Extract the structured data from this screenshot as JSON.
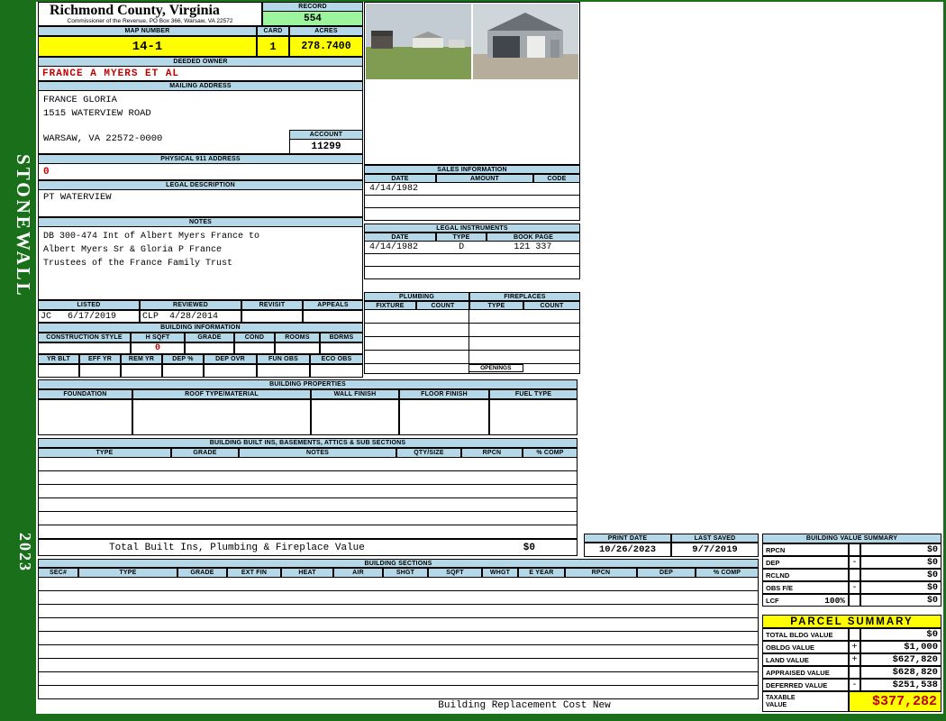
{
  "sidebar": {
    "district": "STONEWALL",
    "year": "2023"
  },
  "header": {
    "county": "Richmond County, Virginia",
    "commissioner_line": "Commissioner of the Revenue, PO Box 366, Warsaw, VA 22572",
    "record": {
      "label": "RECORD",
      "value": "554"
    },
    "map_number": {
      "label": "MAP NUMBER",
      "value": "14-1"
    },
    "card": {
      "label": "CARD",
      "value": "1"
    },
    "acres": {
      "label": "ACRES",
      "value": "278.7400"
    }
  },
  "owner": {
    "deeded_owner": {
      "label": "DEEDED OWNER",
      "value": "FRANCE A MYERS ET AL"
    },
    "mailing": {
      "label": "MAILING ADDRESS",
      "line1": "FRANCE GLORIA",
      "line2": "1515 WATERVIEW ROAD",
      "line3": "WARSAW, VA 22572-0000"
    },
    "account": {
      "label": "ACCOUNT",
      "value": "11299"
    },
    "physical911": {
      "label": "PHYSICAL 911 ADDRESS",
      "value": "0"
    },
    "legal_description": {
      "label": "LEGAL DESCRIPTION",
      "value": "PT WATERVIEW"
    },
    "notes": {
      "label": "NOTES",
      "line1": "DB 300-474 Int of Albert Myers France to",
      "line2": "Albert Myers Sr & Gloria P France",
      "line3": "Trustees of the France Family Trust"
    }
  },
  "sales": {
    "title": "SALES INFORMATION",
    "columns": [
      "DATE",
      "AMOUNT",
      "CODE"
    ],
    "rows": [
      [
        "4/14/1982",
        "",
        ""
      ]
    ]
  },
  "legal_instruments": {
    "title": "LEGAL INSTRUMENTS",
    "columns": [
      "DATE",
      "TYPE",
      "BOOK PAGE"
    ],
    "rows": [
      [
        "4/14/1982",
        "D",
        "121 337"
      ]
    ]
  },
  "plumbing": {
    "title": "PLUMBING",
    "columns": [
      "FIXTURE",
      "COUNT"
    ]
  },
  "fireplaces": {
    "title": "FIREPLACES",
    "columns": [
      "TYPE",
      "COUNT"
    ],
    "openings_label": "OPENINGS"
  },
  "review": {
    "listed_label": "LISTED",
    "listed_value": "JC   6/17/2019",
    "reviewed_label": "REVIEWED",
    "reviewed_value": "CLP  4/28/2014",
    "revisit_label": "REVISIT",
    "revisit_value": "",
    "appeals_label": "APPEALS",
    "appeals_value": ""
  },
  "building_info": {
    "title": "BUILDING INFORMATION",
    "row1_columns": [
      "CONSTRUCTION STYLE",
      "H SQFT",
      "GRADE",
      "COND",
      "ROOMS",
      "BDRMS"
    ],
    "h_sqft_value": "0",
    "row2_columns": [
      "YR BLT",
      "EFF YR",
      "REM YR",
      "DEP %",
      "DEP OVR",
      "FUN OBS",
      "ECO OBS"
    ]
  },
  "building_properties": {
    "title": "BUILDING PROPERTIES",
    "columns": [
      "FOUNDATION",
      "ROOF TYPE/MATERIAL",
      "WALL FINISH",
      "FLOOR FINISH",
      "FUEL TYPE"
    ]
  },
  "built_ins": {
    "title": "BUILDING BUILT INS, BASEMENTS, ATTICS & SUB SECTIONS",
    "columns": [
      "TYPE",
      "GRADE",
      "NOTES",
      "QTY/SIZE",
      "RPCN",
      "% COMP"
    ],
    "total_label": "Total Built Ins, Plumbing & Fireplace Value",
    "total_value": "$0"
  },
  "print_info": {
    "print_date_label": "PRINT DATE",
    "print_date": "10/26/2023",
    "last_saved_label": "LAST SAVED",
    "last_saved": "9/7/2019"
  },
  "building_value_summary": {
    "title": "BUILDING VALUE SUMMARY",
    "rows": [
      {
        "label": "RPCN",
        "op": "",
        "value": "$0"
      },
      {
        "label": "DEP",
        "op": "-",
        "value": "$0"
      },
      {
        "label": "RCLND",
        "op": "",
        "value": "$0"
      },
      {
        "label": "OBS F/E",
        "op": "-",
        "value": "$0"
      },
      {
        "label": "LCF",
        "sub": "100%",
        "op": "",
        "value": "$0"
      }
    ]
  },
  "building_sections": {
    "title": "BUILDING SECTIONS",
    "columns": [
      "SEC#",
      "TYPE",
      "GRADE",
      "EXT FIN",
      "HEAT",
      "AIR",
      "SHGT",
      "SQFT",
      "WHGT",
      "E YEAR",
      "RPCN",
      "DEP",
      "% COMP"
    ]
  },
  "parcel_summary": {
    "title": "PARCEL SUMMARY",
    "rows": [
      {
        "label": "TOTAL BLDG VALUE",
        "op": "",
        "value": "$0"
      },
      {
        "label": "OBLDG VALUE",
        "op": "+",
        "value": "$1,000"
      },
      {
        "label": "LAND VALUE",
        "op": "+",
        "value": "$627,820"
      },
      {
        "label": "APPRAISED VALUE",
        "op": "",
        "value": "$628,820"
      },
      {
        "label": "DEFERRED VALUE",
        "op": "-",
        "value": "$251,538"
      }
    ],
    "taxable": {
      "label": "TAXABLE VALUE",
      "value": "$377,282"
    }
  },
  "footer": {
    "caption": "Building Replacement Cost New"
  },
  "colors": {
    "accent_green": "#1a701a",
    "header_blue": "#b5d8e8",
    "record_green": "#9cf59c",
    "highlight_yellow": "#ffff00",
    "alert_red": "#c00000"
  }
}
